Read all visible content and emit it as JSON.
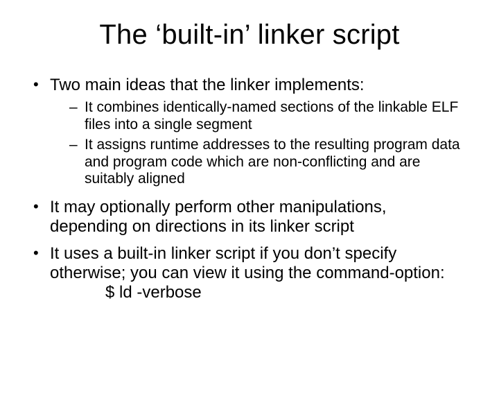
{
  "title": "The ‘built-in’ linker script",
  "bullets": {
    "b1": "Two main ideas that the linker implements:",
    "b1s1": "It combines identically-named sections of the linkable ELF files into a single segment",
    "b1s2": "It assigns runtime addresses to the resulting program data and program code which are non-conflicting and are suitably aligned",
    "b2": "It may optionally perform other manipulations, depending on directions in its linker script",
    "b3a": "It uses a built-in linker script if you don’t specify otherwise; you can view it using the command-option:",
    "b3cmd": "$ ld  -verbose"
  }
}
